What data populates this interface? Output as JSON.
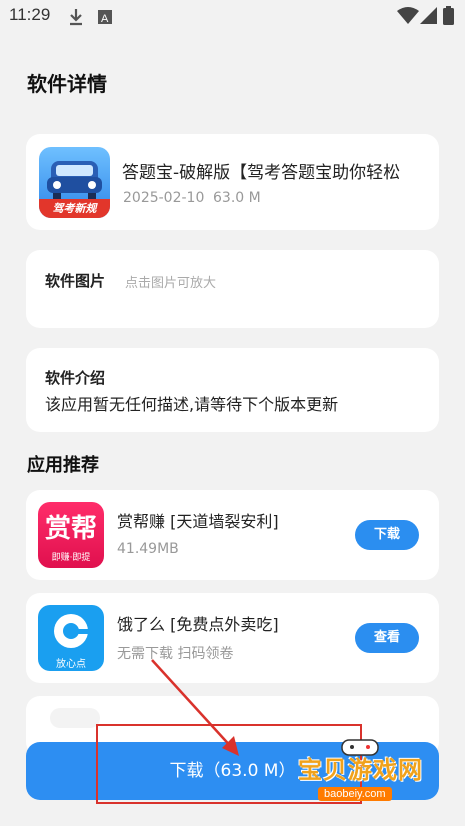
{
  "status_bar": {
    "time": "11:29",
    "icons": [
      "download-icon",
      "font-a-icon",
      "wifi-icon",
      "signal-icon",
      "battery-icon"
    ]
  },
  "page_title": "软件详情",
  "app": {
    "name": "答题宝-破解版【驾考答题宝助你轻松",
    "date": "2025-02-10",
    "size": "63.0 M",
    "icon_badge": "驾考新规"
  },
  "screenshots": {
    "title": "软件图片",
    "hint": "点击图片可放大"
  },
  "intro": {
    "title": "软件介绍",
    "text": "该应用暂无任何描述,请等待下个版本更新"
  },
  "recommend": {
    "title": "应用推荐",
    "items": [
      {
        "name": "赏帮赚 [天道墙裂安利]",
        "meta": "41.49MB",
        "button": "下载",
        "icon_text": "赏帮",
        "icon_sub": "即赚·即提"
      },
      {
        "name": "饿了么 [免费点外卖吃]",
        "meta": "无需下载 扫码领卷",
        "button": "查看",
        "icon_sub": "放心点"
      }
    ]
  },
  "download_button": "下载（63.0 M）",
  "watermark": {
    "text": "宝贝游戏网",
    "url": "baobeiy.com"
  },
  "colors": {
    "accent": "#2d8ef2",
    "annotation": "#d9322c"
  }
}
